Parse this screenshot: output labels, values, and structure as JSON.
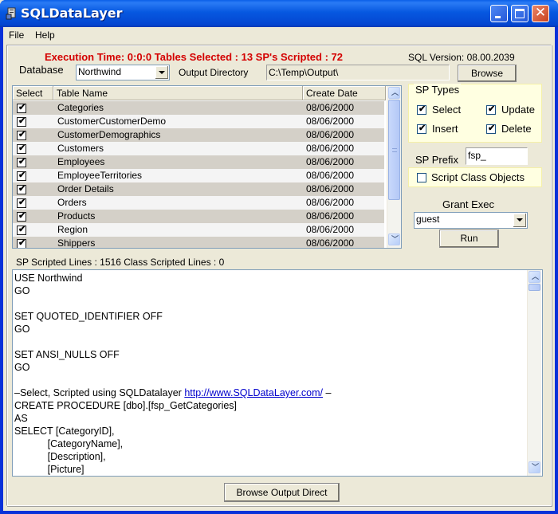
{
  "window": {
    "title": "SQLDataLayer",
    "icon": "database-app-icon",
    "controls": [
      "minimize",
      "maximize",
      "close"
    ]
  },
  "menu": {
    "items": [
      {
        "label": "File"
      },
      {
        "label": "Help"
      }
    ]
  },
  "status": {
    "execution": "Execution Time: 0:0:0 Tables Selected : 13 SP's Scripted : 72",
    "sql_version": "SQL Version: 08.00.2039"
  },
  "database": {
    "label": "Database",
    "selected": "Northwind"
  },
  "output_directory": {
    "label": "Output Directory",
    "value": "C:\\Temp\\Output\\",
    "browse_label": "Browse"
  },
  "table_grid": {
    "columns": [
      "Select",
      "Table Name",
      "Create Date"
    ],
    "rows": [
      {
        "checked": true,
        "name": "Categories",
        "date": "08/06/2000"
      },
      {
        "checked": true,
        "name": "CustomerCustomerDemo",
        "date": "08/06/2000"
      },
      {
        "checked": true,
        "name": "CustomerDemographics",
        "date": "08/06/2000"
      },
      {
        "checked": true,
        "name": "Customers",
        "date": "08/06/2000"
      },
      {
        "checked": true,
        "name": "Employees",
        "date": "08/06/2000"
      },
      {
        "checked": true,
        "name": "EmployeeTerritories",
        "date": "08/06/2000"
      },
      {
        "checked": true,
        "name": "Order Details",
        "date": "08/06/2000"
      },
      {
        "checked": true,
        "name": "Orders",
        "date": "08/06/2000"
      },
      {
        "checked": true,
        "name": "Products",
        "date": "08/06/2000"
      },
      {
        "checked": true,
        "name": "Region",
        "date": "08/06/2000"
      },
      {
        "checked": true,
        "name": "Shippers",
        "date": "08/06/2000"
      }
    ]
  },
  "sp_types": {
    "title": "SP Types",
    "options": [
      {
        "label": "Select",
        "checked": true
      },
      {
        "label": "Update",
        "checked": true
      },
      {
        "label": "Insert",
        "checked": true
      },
      {
        "label": "Delete",
        "checked": true
      }
    ]
  },
  "sp_prefix": {
    "label": "SP Prefix",
    "value": "fsp_"
  },
  "script_class_objects": {
    "label": "Script Class Objects",
    "checked": false
  },
  "grant_exec": {
    "label": "Grant Exec",
    "selected": "guest"
  },
  "run_label": "Run",
  "scripted_lines": "SP Scripted Lines : 1516 Class Scripted Lines : 0",
  "script": {
    "lines": [
      "USE Northwind",
      "GO",
      "",
      "SET QUOTED_IDENTIFIER OFF",
      "GO",
      "",
      "SET ANSI_NULLS OFF",
      "GO",
      "",
      "",
      "CREATE PROCEDURE [dbo].[fsp_GetCategories]",
      "AS",
      "SELECT [CategoryID],",
      "            [CategoryName],",
      "            [Description],",
      "            [Picture]"
    ],
    "comment_prefix": "–Select, Scripted using SQLDatalayer ",
    "comment_link": "http://www.SQLDataLayer.com/",
    "comment_suffix": " –"
  },
  "browse_output_label": "Browse  Output Direct"
}
